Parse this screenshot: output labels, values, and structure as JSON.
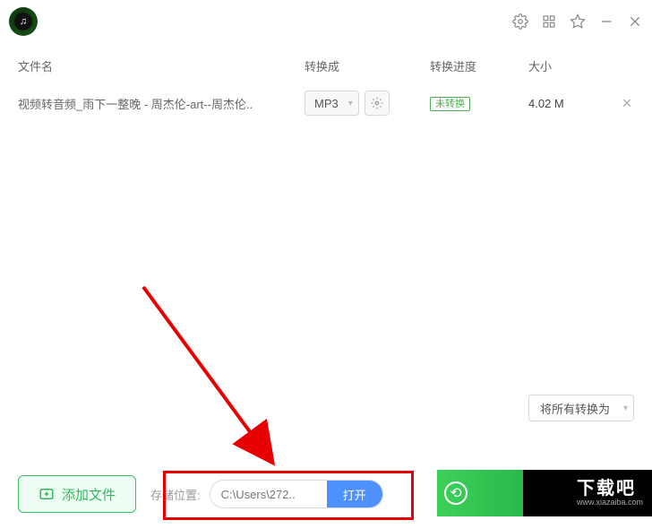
{
  "header": {
    "columns": {
      "name": "文件名",
      "format": "转换成",
      "progress": "转换进度",
      "size": "大小"
    }
  },
  "rows": [
    {
      "filename": "视频转音频_雨下一整晚 - 周杰伦-art--周杰伦..",
      "format": "MP3",
      "status": "未转换",
      "size": "4.02 M"
    }
  ],
  "batch": {
    "convert_all_label": "将所有转换为"
  },
  "bottom": {
    "add_label": "添加文件",
    "path_label": "存储位置:",
    "path_value": "C:\\Users\\272..",
    "open_label": "打开"
  },
  "banner": {
    "text": "下载吧",
    "sub": "www.xiazaiba.com"
  }
}
